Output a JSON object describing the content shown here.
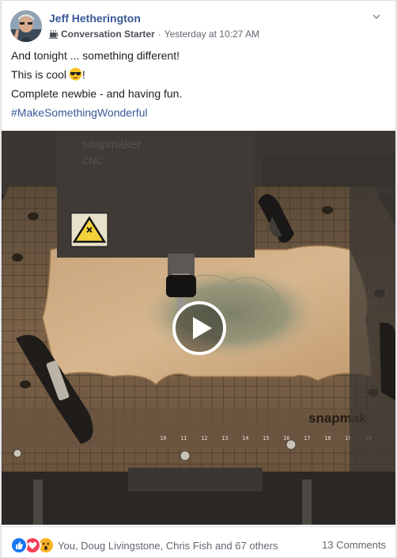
{
  "post": {
    "author": "Jeff Hetherington",
    "badge": "Conversation Starter",
    "separator": "·",
    "timestamp": "Yesterday at 10:27 AM",
    "lines": [
      "And tonight ... something different!",
      "This is cool",
      "!",
      "Complete newbie - and having fun."
    ],
    "hashtag": "#MakeSomethingWonderful"
  },
  "video": {
    "brand_top": "snapmaker",
    "brand_top_sub": "CNC",
    "brand_bed": "snapmak",
    "ruler_numbers": [
      "10",
      "11",
      "12",
      "13",
      "14",
      "15",
      "16",
      "17",
      "18",
      "19",
      "20"
    ]
  },
  "footer": {
    "reaction_icons": [
      "like-icon",
      "love-icon",
      "wow-icon"
    ],
    "reactors": "You, Doug Livingstone, Chris Fish and 67 others",
    "comments": "13 Comments"
  },
  "colors": {
    "link": "#385898",
    "like": "#1877f2",
    "love": "#f33e58",
    "wow": "#f7b125"
  }
}
